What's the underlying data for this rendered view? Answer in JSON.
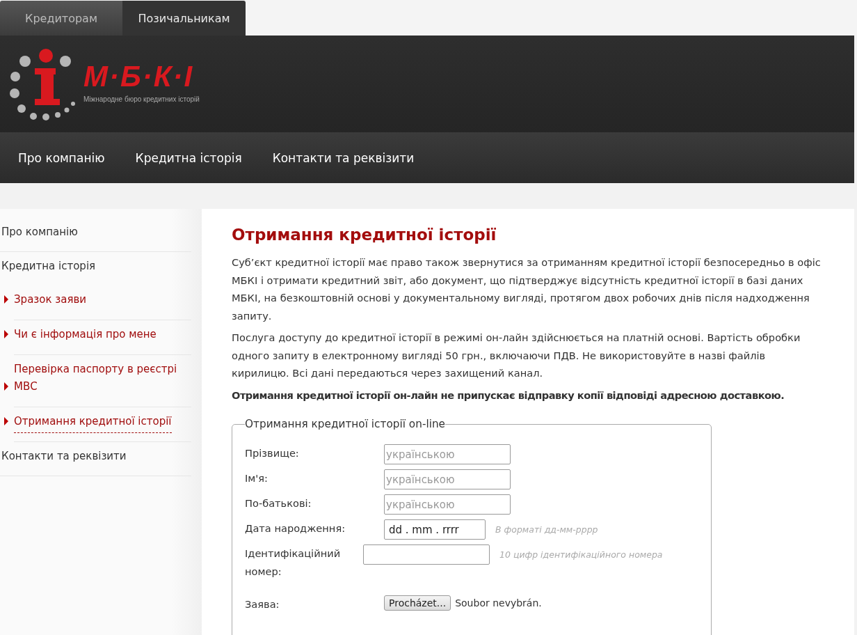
{
  "top_tabs": [
    {
      "label": "Кредиторам",
      "selected": false
    },
    {
      "label": "Позичальникам",
      "selected": true
    }
  ],
  "logo": {
    "title": "М·Б·К·І",
    "subtitle": "Міжнародне бюро кредитних історій"
  },
  "nav": [
    "Про компанію",
    "Кредитна історія",
    "Контакти та реквізити"
  ],
  "sidebar": {
    "items": [
      {
        "label": "Про компанію",
        "selected": false
      },
      {
        "label": "Кредитна історія",
        "selected": false,
        "children": [
          {
            "label": "Зразок заяви",
            "selected": false
          },
          {
            "label": "Чи є інформація про мене",
            "selected": false
          },
          {
            "label": "Перевірка паспорту в реєстрі МВС",
            "selected": false
          },
          {
            "label": "Отримання кредитної історії",
            "selected": true
          }
        ]
      },
      {
        "label": "Контакти та реквізити",
        "selected": false
      }
    ]
  },
  "content": {
    "title": "Отримання кредитної історії",
    "paragraphs": [
      {
        "text": "Суб’єкт кредитної історії має право також звернутися за отриманням кредитної історії безпосередньо в офіс МБКІ і отримати кредитний звіт, або документ, що підтверджує відсутність кредитної історії в базі даних МБКІ, на безкоштовній основі у документальному вигляді, протягом двох робочих днів після надходження запиту.",
        "bold": false
      },
      {
        "text": "Послуга доступу до кредитної історії в режимі он-лайн здійснюється на платній основі. Вартість обробки одного запиту в електронному вигляді 50 грн., включаючи ПДВ. Не використовуйте в назві файлів кирилицю. Всі дані передаються через захищений канал.",
        "bold": false
      },
      {
        "text": "Отримання кредитної історії он-лайн не припускає відправку копії відповіді адресною доставкою.",
        "bold": true
      }
    ],
    "form": {
      "legend": "Отримання кредитної історії on-line",
      "fields": [
        {
          "kind": "text",
          "label": "Прізвище:",
          "placeholder": "українською"
        },
        {
          "kind": "text",
          "label": "Ім'я:",
          "placeholder": "українською"
        },
        {
          "kind": "text",
          "label": "По-батькові:",
          "placeholder": "українською"
        },
        {
          "kind": "date",
          "label": "Дата народження:",
          "value": "dd . mm . rrrr",
          "hint": "В форматі дд-мм-рррр"
        },
        {
          "kind": "text",
          "label": "Ідентифікаційний номер:",
          "hint": "10 цифр ідентифікаційного номера"
        },
        {
          "kind": "file",
          "label": "Заява:",
          "button": "Procházet...",
          "status": "Soubor nevybrán."
        }
      ]
    }
  }
}
